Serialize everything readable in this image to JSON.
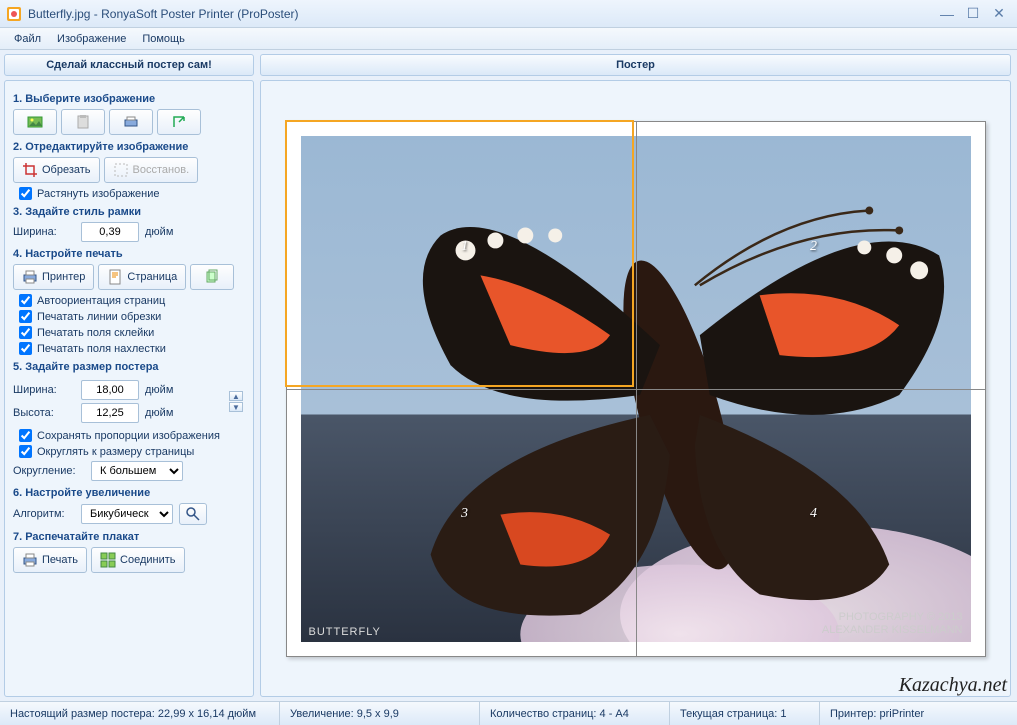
{
  "window": {
    "title": "Butterfly.jpg - RonyaSoft Poster Printer (ProPoster)"
  },
  "menu": {
    "file": "Файл",
    "image": "Изображение",
    "help": "Помощь"
  },
  "sidebar": {
    "header": "Сделай классный постер сам!",
    "s1": {
      "title": "1. Выберите изображение"
    },
    "s2": {
      "title": "2. Отредактируйте изображение",
      "crop": "Обрезать",
      "restore": "Восстанов.",
      "stretch": "Растянуть изображение"
    },
    "s3": {
      "title": "3. Задайте стиль рамки",
      "width_label": "Ширина:",
      "width_value": "0,39",
      "unit": "дюйм"
    },
    "s4": {
      "title": "4. Настройте печать",
      "printer": "Принтер",
      "page": "Страница",
      "auto_orient": "Автоориентация страниц",
      "print_cut": "Печатать линии обрезки",
      "print_glue": "Печатать поля склейки",
      "print_overlap": "Печатать поля нахлестки"
    },
    "s5": {
      "title": "5. Задайте размер постера",
      "width_label": "Ширина:",
      "width_value": "18,00",
      "height_label": "Высота:",
      "height_value": "12,25",
      "unit": "дюйм",
      "keep_ratio": "Сохранять пропорции изображения",
      "round_page": "Округлять к размеру страницы",
      "rounding_label": "Округление:",
      "rounding_value": "К большем"
    },
    "s6": {
      "title": "6. Настройте увеличение",
      "algo_label": "Алгоритм:",
      "algo_value": "Бикубическ"
    },
    "s7": {
      "title": "7. Распечатайте плакат",
      "print": "Печать",
      "join": "Соединить"
    }
  },
  "preview": {
    "header": "Постер",
    "pages": {
      "p1": "1",
      "p2": "2",
      "p3": "3",
      "p4": "4"
    },
    "caption": "BUTTERFLY",
    "credit_line1": "PHOTOGRAPHY © 2013",
    "credit_line2": "ALEXANDER KISSELMANN"
  },
  "status": {
    "real_size": "Настоящий размер постера: 22,99 x 16,14 дюйм",
    "zoom": "Увеличение: 9,5 x 9,9",
    "page_count": "Количество страниц: 4 - A4",
    "current_page": "Текущая страница: 1",
    "printer": "Принтер: priPrinter"
  },
  "watermark": "Kazachya.net"
}
